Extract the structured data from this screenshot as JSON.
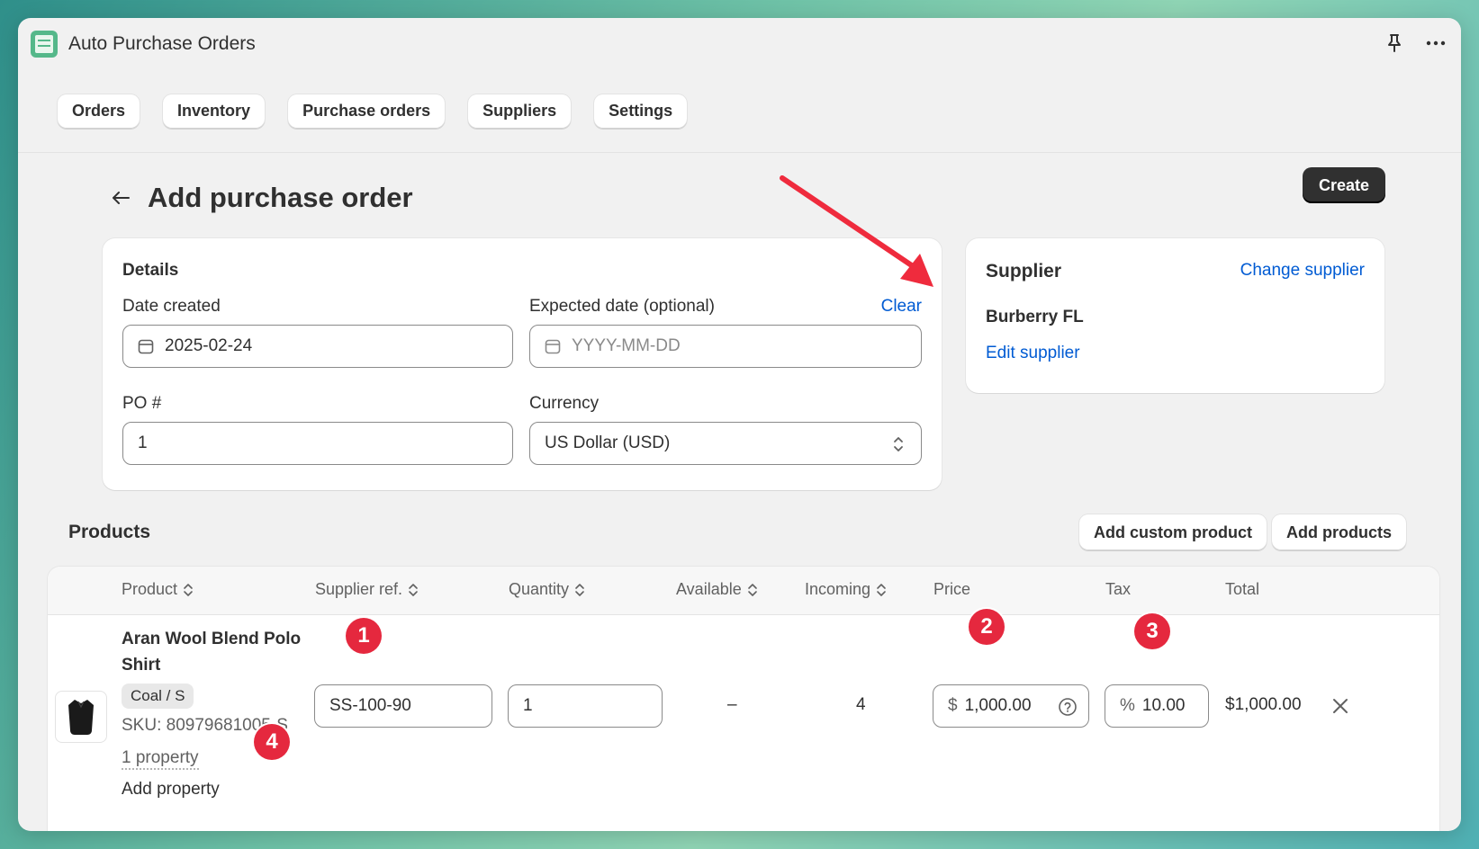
{
  "app": {
    "title": "Auto Purchase Orders"
  },
  "nav": {
    "items": [
      "Orders",
      "Inventory",
      "Purchase orders",
      "Suppliers",
      "Settings"
    ]
  },
  "page": {
    "title": "Add purchase order",
    "create_label": "Create"
  },
  "details": {
    "heading": "Details",
    "date_created_label": "Date created",
    "date_created_value": "2025-02-24",
    "expected_date_label": "Expected date (optional)",
    "expected_date_placeholder": "YYYY-MM-DD",
    "clear_label": "Clear",
    "po_label": "PO #",
    "po_value": "1",
    "currency_label": "Currency",
    "currency_value": "US Dollar (USD)"
  },
  "supplier": {
    "heading": "Supplier",
    "change_label": "Change supplier",
    "name": "Burberry FL",
    "edit_label": "Edit supplier"
  },
  "products": {
    "heading": "Products",
    "add_custom_label": "Add custom product",
    "add_products_label": "Add products",
    "columns": [
      "Product",
      "Supplier ref.",
      "Quantity",
      "Available",
      "Incoming",
      "Price",
      "Tax",
      "Total"
    ],
    "rows": [
      {
        "name_line1": "Aran Wool Blend Polo",
        "name_line2": "Shirt",
        "variant": "Coal / S",
        "sku": "SKU: 80979681005-S",
        "property_count": "1 property",
        "add_property_label": "Add property",
        "supplier_ref": "SS-100-90",
        "quantity": "1",
        "available": "–",
        "incoming": "4",
        "price_prefix": "$",
        "price": "1,000.00",
        "tax_prefix": "%",
        "tax": "10.00",
        "total": "$1,000.00"
      }
    ]
  },
  "markers": [
    "1",
    "2",
    "3",
    "4"
  ],
  "colors": {
    "accent_link": "#005bd3",
    "marker_red": "#e5283e",
    "primary_button": "#303030"
  }
}
